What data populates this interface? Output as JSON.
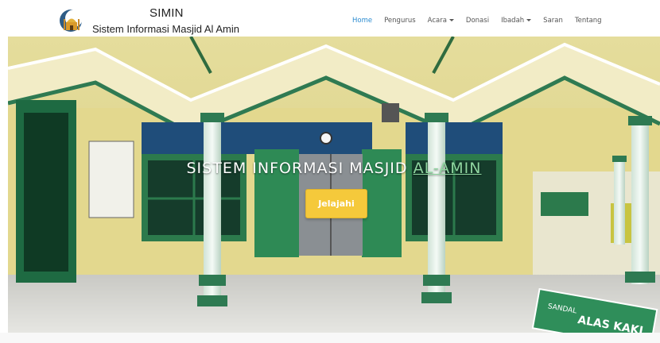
{
  "brand": {
    "title": "SIMIN",
    "subtitle": "Sistem Informasi Masjid Al Amin"
  },
  "nav": {
    "items": [
      {
        "label": "Home",
        "active": true
      },
      {
        "label": "Pengurus"
      },
      {
        "label": "Acara",
        "dropdown": true
      },
      {
        "label": "Donasi"
      },
      {
        "label": "Ibadah",
        "dropdown": true
      },
      {
        "label": "Saran"
      },
      {
        "label": "Tentang"
      }
    ]
  },
  "hero": {
    "title_main": "SISTEM INFORMASI MASJID",
    "title_accent": "AL-AMIN",
    "button_label": "Jelajahi",
    "sign_text_1": "SANDAL",
    "sign_text_2": "ALAS KAKI"
  },
  "colors": {
    "accent": "#2a8bd0",
    "button": "#f5c93b",
    "trim_green": "#1e6b45",
    "wall_yellow": "#e8dd9a"
  }
}
